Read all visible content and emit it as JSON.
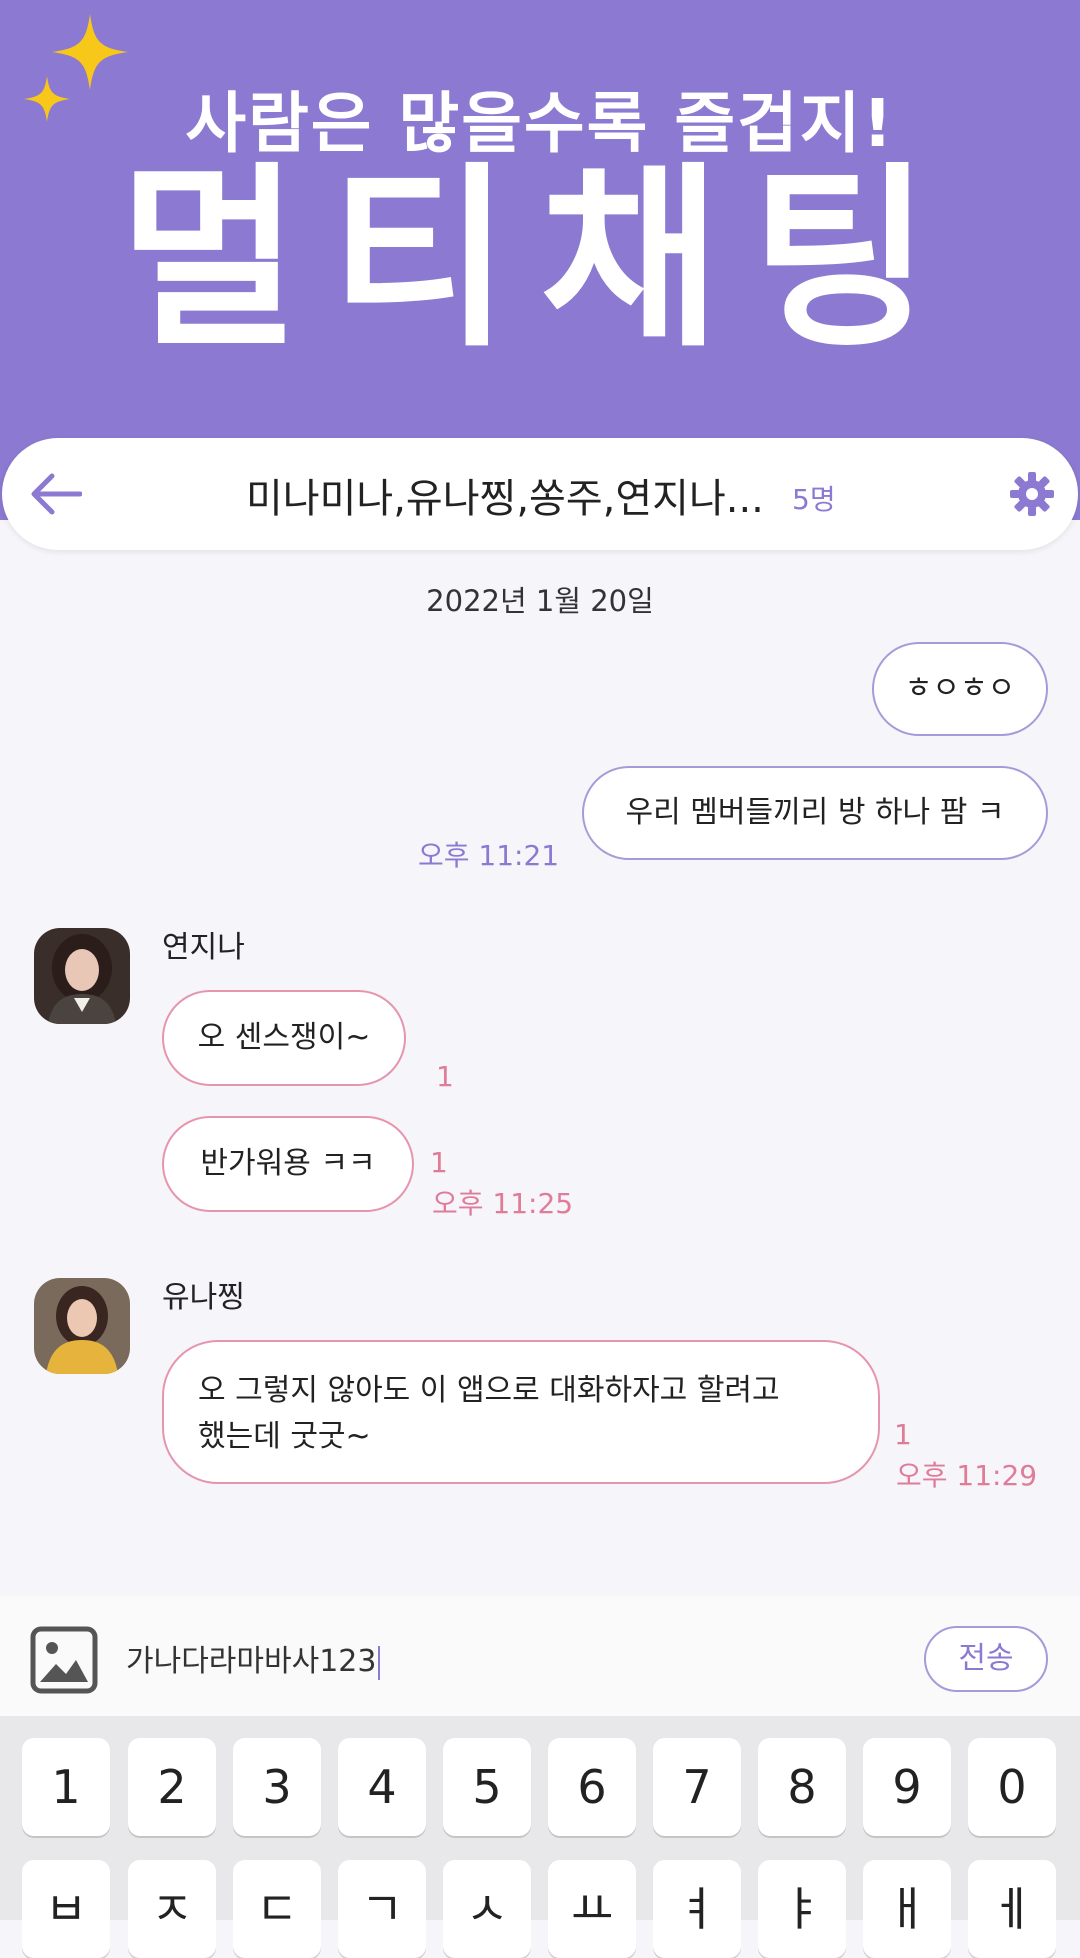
{
  "promo": {
    "subtitle": "사람은 많을수록 즐겁지!",
    "title": "멀티채팅"
  },
  "header": {
    "title": "미나미나,유나찡,쏭주,연지나...",
    "member_count": "5명"
  },
  "date_separator": "2022년 1월 20일",
  "messages": [
    {
      "side": "mine",
      "text": "ㅎㅇㅎㅇ"
    },
    {
      "side": "mine",
      "text": "우리 멤버들끼리 방 하나 팜 ㅋ",
      "time": "오후 11:21"
    },
    {
      "sender": "연지나",
      "text": "오 센스쟁이~",
      "unread": "1"
    },
    {
      "sender": "연지나",
      "text": "반가워용 ㅋㅋ",
      "unread": "1",
      "time": "오후 11:25"
    },
    {
      "sender": "유나찡",
      "text_line1": "오 그렇지 않아도 이 앱으로 대화하자고 할려고",
      "text_line2": "했는데 굿굿~",
      "unread": "1",
      "time": "오후 11:29"
    }
  ],
  "input": {
    "value": "가나다라마바사123",
    "send_label": "전송"
  },
  "keyboard": {
    "number_row": [
      "1",
      "2",
      "3",
      "4",
      "5",
      "6",
      "7",
      "8",
      "9",
      "0"
    ],
    "second_row": [
      "ㅂ",
      "ㅈ",
      "ㄷ",
      "ㄱ",
      "ㅅ",
      "ㅛ",
      "ㅕ",
      "ㅑ",
      "ㅐ",
      "ㅔ"
    ]
  },
  "colors": {
    "accent": "#8c79d1",
    "pink": "#e07b98",
    "banner": "#8c79d1",
    "sparkle": "#f7c71a"
  }
}
